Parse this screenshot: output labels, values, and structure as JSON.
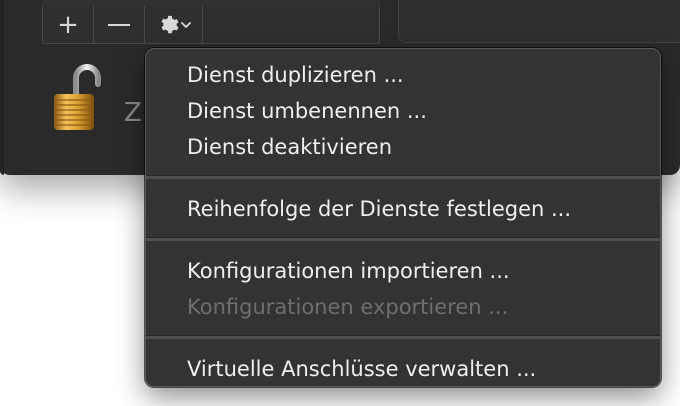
{
  "toolbar": {
    "add_symbol": "+",
    "remove_symbol": "—",
    "action_symbol": "⚙",
    "chevron_symbol": "⌄"
  },
  "lock": {
    "label_partial": "Z"
  },
  "menu": {
    "items": [
      {
        "label": "Dienst duplizieren ...",
        "enabled": true
      },
      {
        "label": "Dienst umbenennen ...",
        "enabled": true
      },
      {
        "label": "Dienst deaktivieren",
        "enabled": true
      },
      {
        "label": "Reihenfolge der Dienste festlegen ...",
        "enabled": true
      },
      {
        "label": "Konfigurationen importieren ...",
        "enabled": true
      },
      {
        "label": "Konfigurationen exportieren ...",
        "enabled": false
      },
      {
        "label": "Virtuelle Anschlüsse verwalten ...",
        "enabled": true
      }
    ]
  },
  "colors": {
    "menu_bg": "#333333",
    "window_bg": "#2a2a2a",
    "text": "#efefef",
    "disabled_text": "#6e6e6e",
    "lock_gold": "#d9a030"
  }
}
